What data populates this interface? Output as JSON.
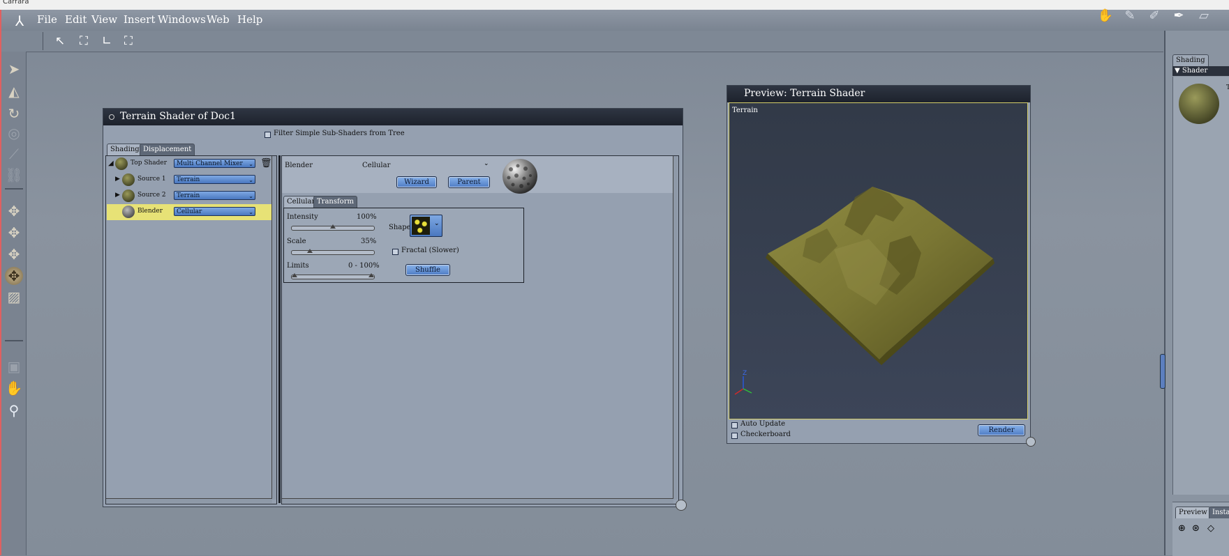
{
  "window": {
    "title": "Carrara"
  },
  "menubar": {
    "items": [
      "File",
      "Edit",
      "View",
      "Insert",
      "Windows",
      "Web",
      "Help"
    ]
  },
  "shader_window": {
    "title": "Terrain Shader of Doc1",
    "filter_label": "Filter Simple Sub-Shaders from Tree",
    "tabs": [
      "Shading",
      "Displacement"
    ],
    "tree": [
      {
        "label": "Top Shader",
        "value": "Multi Channel Mixer"
      },
      {
        "label": "Source 1",
        "value": "Terrain"
      },
      {
        "label": "Source 2",
        "value": "Terrain"
      },
      {
        "label": "Blender",
        "value": "Cellular"
      }
    ],
    "editor": {
      "name_label": "Blender",
      "type_value": "Cellular",
      "wizard_label": "Wizard",
      "parent_label": "Parent",
      "subtabs": [
        "Cellular",
        "Transform"
      ],
      "intensity": {
        "label": "Intensity",
        "value": "100%",
        "level": 0.5
      },
      "scale": {
        "label": "Scale",
        "value": "35%",
        "level": 0.2
      },
      "limits": {
        "label": "Limits",
        "value": "0 - 100%",
        "low": 0,
        "high": 1
      },
      "shape_label": "Shape",
      "fractal_label": "Fractal (Slower)",
      "shuffle_label": "Shuffle"
    }
  },
  "preview": {
    "title": "Preview: Terrain Shader",
    "object_label": "Terrain",
    "auto_update_label": "Auto Update",
    "checkerboard_label": "Checkerboard",
    "render_label": "Render",
    "axis_z": "Z"
  },
  "right_panel": {
    "tab_shading": "Shading",
    "shader_header": "Shader",
    "item_label": "Te",
    "tab_preview": "Preview",
    "tab_instances": "Instance"
  },
  "colors": {
    "accent": "#4a78c0",
    "selection": "#e7e276",
    "terrain": "#7e7a36"
  }
}
